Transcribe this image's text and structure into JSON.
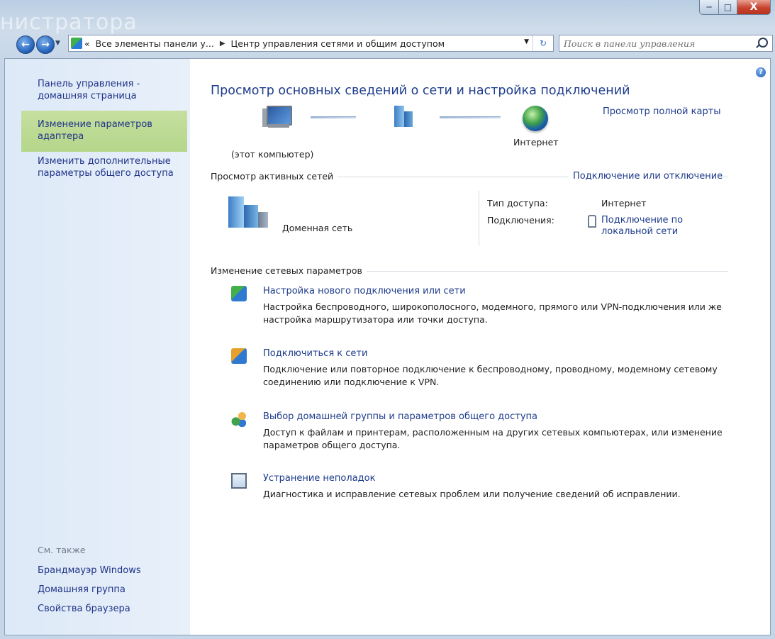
{
  "window": {
    "title_ghost": "нистратора",
    "caption": {
      "minimize": "─",
      "maximize": "□",
      "close": "X"
    }
  },
  "navbar": {
    "back_icon": "←",
    "forward_icon": "→",
    "dropdown": "▼",
    "address": {
      "prefix": "«",
      "segment1": "Все элементы панели у...",
      "separator": "▶",
      "segment2": "Центр управления сетями и общим доступом",
      "dropdown": "▼",
      "refresh": "↻"
    },
    "search_placeholder": "Поиск в панели управления"
  },
  "sidebar": {
    "home": "Панель управления - домашняя страница",
    "change_adapter": "Изменение параметров адаптера",
    "advanced_sharing": "Изменить дополнительные параметры общего доступа",
    "see_also": "См. также",
    "firewall": "Брандмауэр Windows",
    "homegroup": "Домашняя группа",
    "browser_props": "Свойства браузера"
  },
  "main": {
    "help": "?",
    "title": "Просмотр основных сведений о сети и настройка подключений",
    "full_map": "Просмотр полной карты",
    "this_computer": "(этот компьютер)",
    "internet": "Интернет",
    "active_networks": "Просмотр активных сетей",
    "connect_disconnect": "Подключение или отключение",
    "network_name": "Доменная сеть",
    "access_type_label": "Тип доступа:",
    "access_type_value": "Интернет",
    "connections_label": "Подключения:",
    "connections_value": "Подключение по локальной сети",
    "change_settings": "Изменение сетевых параметров",
    "tasks": [
      {
        "icon": "new-connection-icon",
        "link": "Настройка нового подключения или сети",
        "desc": "Настройка беспроводного, широкополосного, модемного, прямого или VPN-подключения или же настройка маршрутизатора или точки доступа."
      },
      {
        "icon": "connect-network-icon",
        "link": "Подключиться к сети",
        "desc": "Подключение или повторное подключение к беспроводному, проводному, модемному сетевому соединению или подключение к VPN."
      },
      {
        "icon": "homegroup-icon",
        "link": "Выбор домашней группы и параметров общего доступа",
        "desc": "Доступ к файлам и принтерам, расположенным на других сетевых компьютерах, или изменение параметров общего доступа."
      },
      {
        "icon": "troubleshoot-icon",
        "link": "Устранение неполадок",
        "desc": "Диагностика и исправление сетевых проблем или получение сведений об исправлении."
      }
    ]
  }
}
